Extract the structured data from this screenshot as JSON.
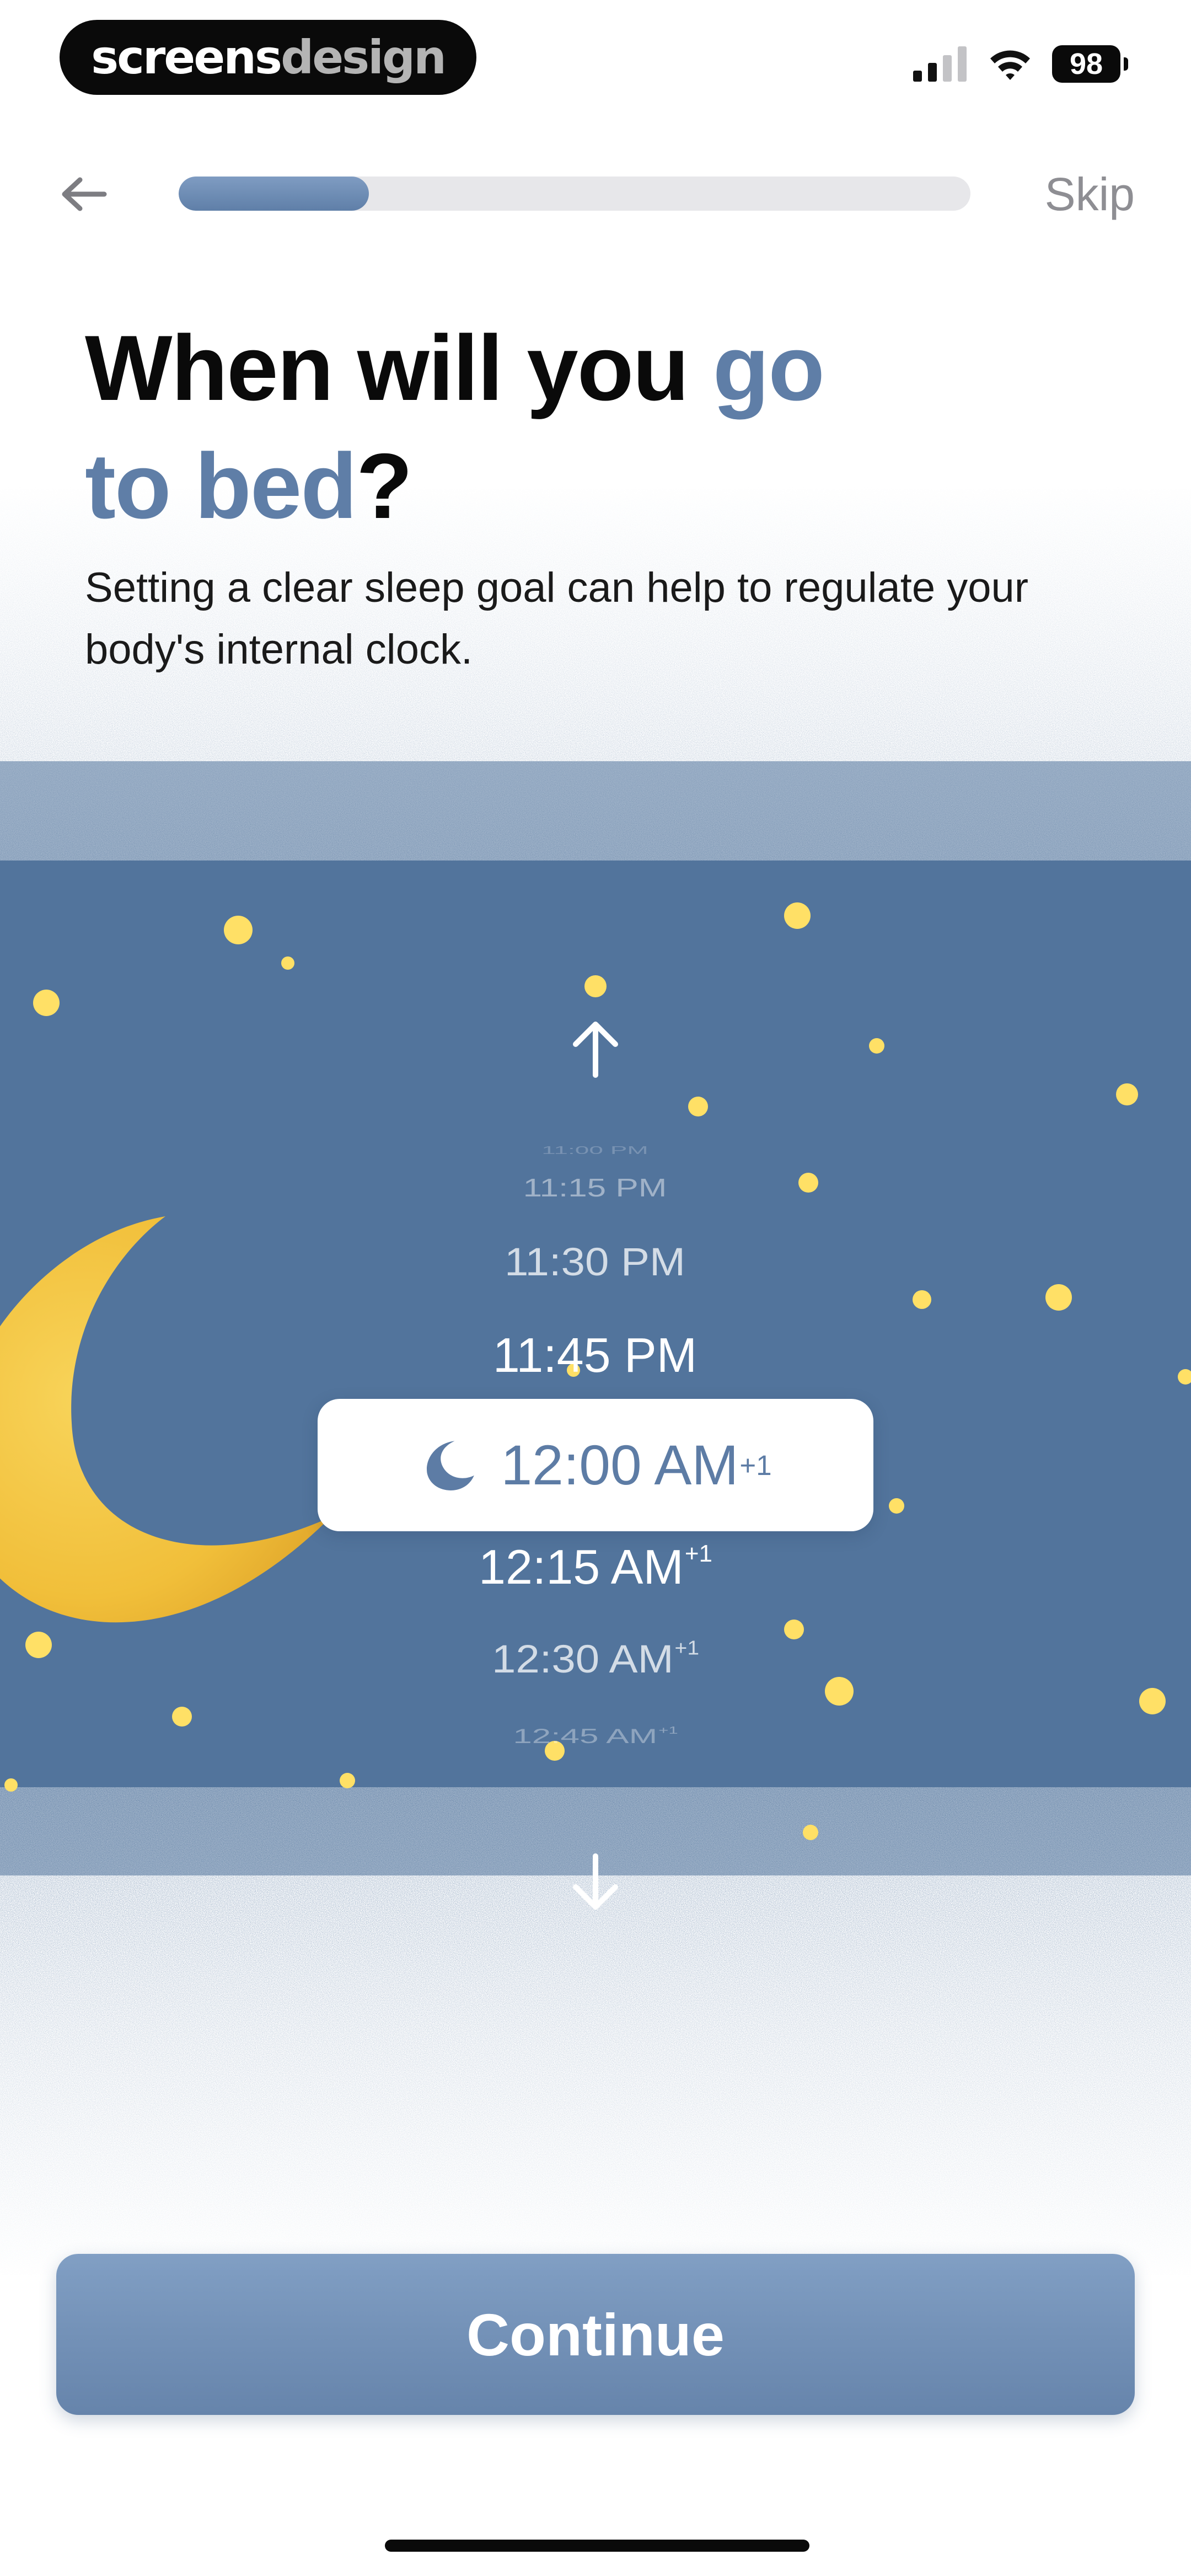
{
  "status_bar": {
    "brand_primary": "screens",
    "brand_secondary": "design",
    "battery_level": "98"
  },
  "nav": {
    "skip_label": "Skip",
    "progress": 0.24
  },
  "heading": {
    "title_part1": "When will you ",
    "title_accent1": "go",
    "title_accent2": "to bed",
    "title_end": "?",
    "subtitle": "Setting a clear sleep goal can help to regulate your body's internal clock."
  },
  "picker": {
    "items": [
      {
        "time": "11:00 PM",
        "plus": ""
      },
      {
        "time": "11:15 PM",
        "plus": ""
      },
      {
        "time": "11:30 PM",
        "plus": ""
      },
      {
        "time": "11:45 PM",
        "plus": ""
      },
      {
        "time": "12:00 AM",
        "plus": "+1"
      },
      {
        "time": "12:15 AM",
        "plus": "+1"
      },
      {
        "time": "12:30 AM",
        "plus": "+1"
      },
      {
        "time": "12:45 AM",
        "plus": "+1"
      }
    ]
  },
  "footer": {
    "continue_label": "Continue"
  },
  "colors": {
    "accent": "#5f7ea7",
    "sky": "#52749c",
    "moon": "#f2c23e",
    "star": "#ffe066"
  },
  "icons": {
    "back": "arrow-left-icon",
    "up": "arrow-up-icon",
    "down": "arrow-down-icon",
    "selected": "moon-icon"
  }
}
